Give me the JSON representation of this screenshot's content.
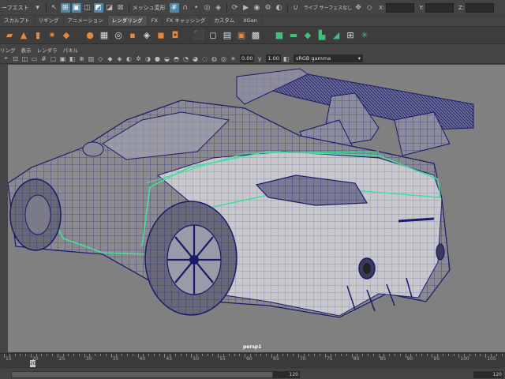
{
  "statusline": {
    "menu_fragments": [
      "ーフエスト",
      "メッシュ変形"
    ],
    "live_surface_label": "ライブ サーフェスなし",
    "x_label": "X:",
    "y_label": "Y:",
    "z_label": "Z:"
  },
  "shelf_tabs": [
    {
      "label": "スカルプト"
    },
    {
      "label": "リギング"
    },
    {
      "label": "アニメーション"
    },
    {
      "label": "レンダリング"
    },
    {
      "label": "FX"
    },
    {
      "label": "FX キャッシング"
    },
    {
      "label": "カスタム"
    },
    {
      "label": "XGen"
    }
  ],
  "panel_menu": [
    "リング",
    "表示",
    "レンダラ",
    "パネル"
  ],
  "panel_toolbar": {
    "exposure_value": "0.00",
    "gamma_value": "1.00",
    "color_space": "sRGB gamma"
  },
  "viewport": {
    "camera_label": "persp1"
  },
  "timeslider": {
    "ticks": [
      "15",
      "20",
      "25",
      "30",
      "35",
      "40",
      "45",
      "50",
      "55",
      "60",
      "65",
      "70",
      "75",
      "80",
      "85",
      "90",
      "95",
      "100",
      "105"
    ],
    "current_frame": "20"
  },
  "range": {
    "end_value": "120",
    "anim_end_value": "120"
  },
  "colors": {
    "viewport_bg": "#808080",
    "wire": "#1a1a7a",
    "selection": "#3fe0a0",
    "active_tool": "#5285a6"
  }
}
